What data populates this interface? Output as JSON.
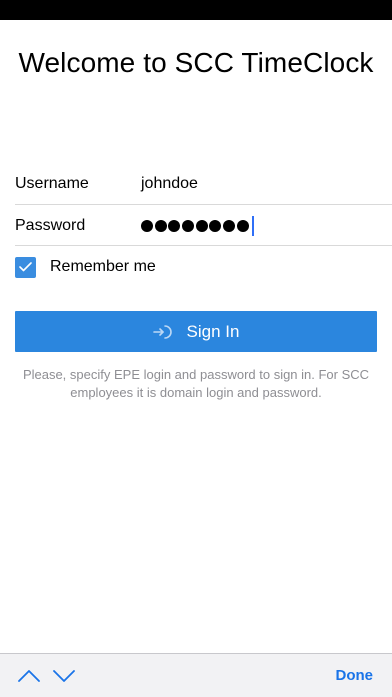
{
  "title": "Welcome to SCC TimeClock",
  "form": {
    "username_label": "Username",
    "username_value": "johndoe",
    "password_label": "Password",
    "password_masked_length": 8,
    "remember_label": "Remember me",
    "remember_checked": true
  },
  "signin": {
    "label": "Sign In",
    "icon": "sign-in-icon"
  },
  "hint": "Please, specify EPE login and password to sign in. For SCC employees it is domain login and password.",
  "keyboard_toolbar": {
    "prev_icon": "chevron-up-icon",
    "next_icon": "chevron-down-icon",
    "done_label": "Done"
  },
  "colors": {
    "accent": "#2b86de",
    "checkbox": "#3a8de0",
    "done": "#1a74e8",
    "caret": "#2f6ff7",
    "hint_text": "#8e8e93"
  }
}
